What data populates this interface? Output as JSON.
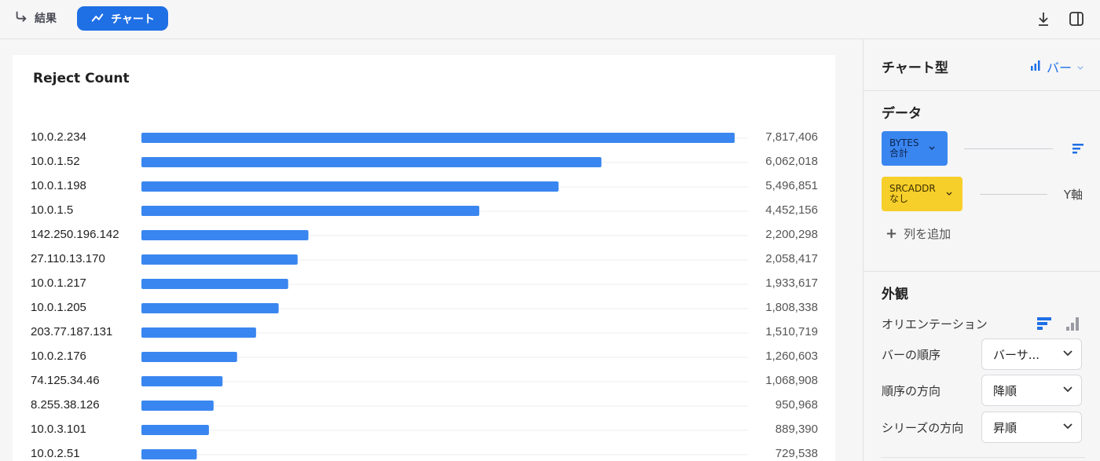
{
  "topbar": {
    "result_tab": "結果",
    "chart_tab": "チャート",
    "icons": [
      "download-icon",
      "panel-toggle-icon"
    ]
  },
  "chart_data": {
    "type": "bar",
    "orientation": "horizontal",
    "title": "Reject Count",
    "categories": [
      "10.0.2.234",
      "10.0.1.52",
      "10.0.1.198",
      "10.0.1.5",
      "142.250.196.142",
      "27.110.13.170",
      "10.0.1.217",
      "10.0.1.205",
      "203.77.187.131",
      "10.0.2.176",
      "74.125.34.46",
      "8.255.38.126",
      "10.0.3.101",
      "10.0.2.51"
    ],
    "values": [
      7817406,
      6062018,
      5496851,
      4452156,
      2200298,
      2058417,
      1933617,
      1808338,
      1510719,
      1260603,
      1068908,
      950968,
      889390,
      729538
    ],
    "value_labels": [
      "7,817,406",
      "6,062,018",
      "5,496,851",
      "4,452,156",
      "2,200,298",
      "2,058,417",
      "1,933,617",
      "1,808,338",
      "1,510,719",
      "1,260,603",
      "1,068,908",
      "950,968",
      "889,390",
      "729,538"
    ],
    "bar_color": "#3a86f0",
    "grid": true
  },
  "panel": {
    "chart_type_title": "チャート型",
    "chart_type_value": "バー",
    "data_title": "データ",
    "chips": [
      {
        "line1": "BYTES",
        "line2": "合計",
        "color": "#3a86f0"
      },
      {
        "line1": "SRCADDR",
        "line2": "なし",
        "color": "#f7cf2b"
      }
    ],
    "y_axis_label": "Y軸",
    "add_column": "列を追加",
    "appearance_title": "外観",
    "orientation_label": "オリエンテーション",
    "bar_order_label": "バーの順序",
    "bar_order_value": "バーサ...",
    "order_direction_label": "順序の方向",
    "order_direction_value": "降順",
    "series_direction_label": "シリーズの方向",
    "series_direction_value": "昇順",
    "accent_color": "#1f6fe5"
  }
}
